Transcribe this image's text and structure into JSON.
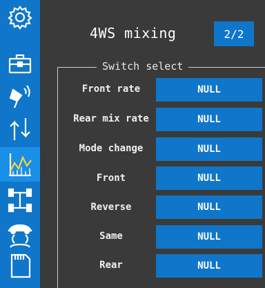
{
  "header": {
    "title": "4WS mixing",
    "page_indicator": "2/2"
  },
  "group": {
    "legend": "Switch select"
  },
  "rows": [
    {
      "label": "Front rate",
      "value": "NULL"
    },
    {
      "label": "Rear mix rate",
      "value": "NULL"
    },
    {
      "label": "Mode change",
      "value": "NULL"
    },
    {
      "label": "Front",
      "value": "NULL"
    },
    {
      "label": "Reverse",
      "value": "NULL"
    },
    {
      "label": "Same",
      "value": "NULL"
    },
    {
      "label": "Rear",
      "value": "NULL"
    }
  ],
  "sidebar": {
    "icons": [
      "gear-icon",
      "toolbox-icon",
      "transmitter-icon",
      "up-down-arrows-icon",
      "chart-icon",
      "car-chassis-icon",
      "car-swap-icon",
      "sd-card-icon"
    ],
    "active_index": 4
  },
  "colors": {
    "background": "#3a3a3a",
    "accent": "#0f76c9",
    "accent_active": "#1a8fe6",
    "text": "#ffffff"
  }
}
